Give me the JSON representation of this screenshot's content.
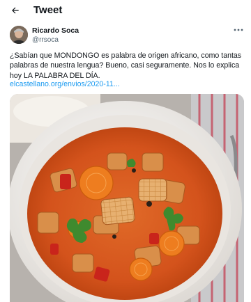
{
  "header": {
    "title": "Tweet",
    "back_icon": "arrow-left-icon"
  },
  "author": {
    "name": "Ricardo Soca",
    "handle": "@rrsoca",
    "more_icon": "more-horizontal-icon"
  },
  "tweet": {
    "line1": "¿Sabían que MONDONGO es palabra de origen africano, como tantas",
    "line2": "palabras de nuestra lengua? Bueno, casi seguramente.  Nos lo explica",
    "line3": "hoy LA PALABRA DEL DÍA.",
    "link": "elcastellano.org/envios/2020-11..."
  },
  "media": {
    "colors": {
      "soup": "#d8591f",
      "bowl": "#f4f2ef",
      "carrot": "#ec7a1c",
      "pepper": "#c8261a",
      "cilantro": "#3f8a2e",
      "tripe": "#e0a868"
    }
  }
}
